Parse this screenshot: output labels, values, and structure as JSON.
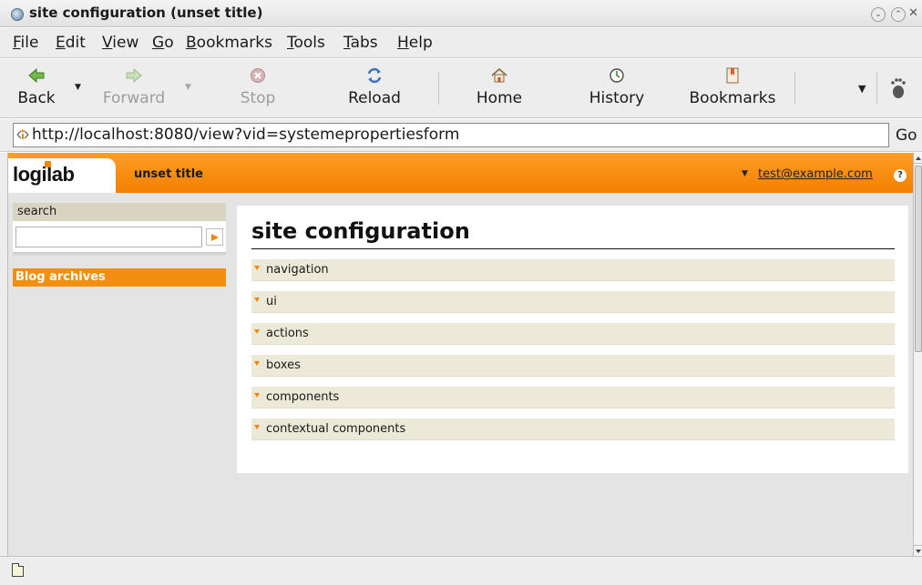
{
  "window": {
    "title": "site configuration (unset title)"
  },
  "menubar": {
    "items": [
      "File",
      "Edit",
      "View",
      "Go",
      "Bookmarks",
      "Tools",
      "Tabs",
      "Help"
    ]
  },
  "toolbar": {
    "back_label": "Back",
    "forward_label": "Forward",
    "stop_label": "Stop",
    "reload_label": "Reload",
    "home_label": "Home",
    "history_label": "History",
    "bookmarks_label": "Bookmarks"
  },
  "addressbar": {
    "url": "http://localhost:8080/view?vid=systemepropertiesform",
    "go_label": "Go"
  },
  "site": {
    "logo_text": "logilab",
    "title": "unset title",
    "user": "test@example.com",
    "help_symbol": "?"
  },
  "sidebar": {
    "search_label": "search",
    "search_value": "",
    "blog_archives_label": "Blog archives"
  },
  "main": {
    "heading": "site configuration",
    "sections": [
      {
        "label": "navigation"
      },
      {
        "label": "ui"
      },
      {
        "label": "actions"
      },
      {
        "label": "boxes"
      },
      {
        "label": "components"
      },
      {
        "label": "contextual components"
      }
    ]
  },
  "statusbar": {
    "text": ""
  },
  "colors": {
    "accent": "#f28600",
    "section_bg": "#ece9d8",
    "header_orange": "#ff9e26"
  }
}
